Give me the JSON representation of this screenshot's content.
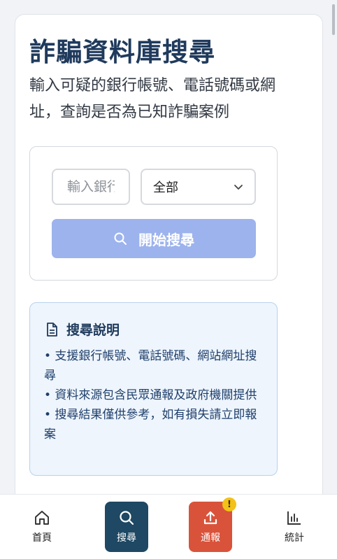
{
  "page": {
    "title": "詐騙資料庫搜尋",
    "subtitle": "輸入可疑的銀行帳號、電話號碼或網址，查詢是否為已知詐騙案例"
  },
  "search": {
    "input_placeholder": "輸入銀行",
    "input_value": "",
    "type_selected": "全部",
    "button_label": "開始搜尋"
  },
  "help": {
    "title": "搜尋說明",
    "items": [
      "• 支援銀行帳號、電話號碼、網站網址搜尋",
      "• 資料來源包含民眾通報及政府機關提供",
      "• 搜尋結果僅供參考，如有損失請立即報案"
    ]
  },
  "nav": {
    "home": "首頁",
    "search": "搜尋",
    "report": "通報",
    "report_badge": "!",
    "stats": "統計"
  },
  "colors": {
    "title": "#1f3a5c",
    "button_disabled": "#9db3ed",
    "nav_active": "#1e4863",
    "nav_report": "#d9533b",
    "badge": "#f3c218"
  }
}
